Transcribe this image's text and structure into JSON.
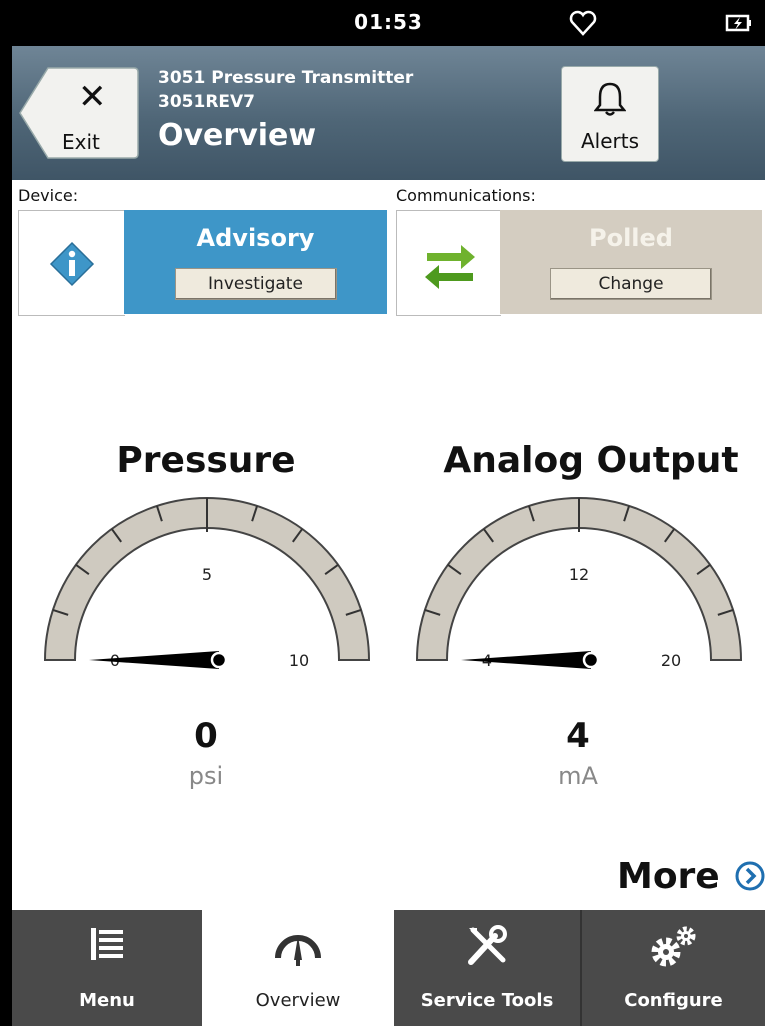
{
  "status_bar": {
    "time": "01:53",
    "heart_icon": "heart-icon",
    "battery_icon": "battery-charging-icon"
  },
  "header": {
    "exit_label": "Exit",
    "device_name": "3051 Pressure Transmitter",
    "device_rev": "3051REV7",
    "title": "Overview",
    "alerts_label": "Alerts"
  },
  "device": {
    "section_label": "Device:",
    "status": "Advisory",
    "button": "Investigate",
    "icon": "info-icon",
    "color": "#3e96c8"
  },
  "communications": {
    "section_label": "Communications:",
    "status": "Polled",
    "button": "Change",
    "icon": "arrows-exchange-icon",
    "color": "#d4cdc1"
  },
  "gauges": [
    {
      "title": "Pressure",
      "min": "0",
      "mid": "5",
      "max": "10",
      "value": "0",
      "unit": "psi",
      "needle_fraction": 0
    },
    {
      "title": "Analog Output",
      "min": "4",
      "mid": "12",
      "max": "20",
      "value": "4",
      "unit": "mA",
      "needle_fraction": 0
    }
  ],
  "more_label": "More",
  "nav": [
    {
      "label": "Menu",
      "icon": "menu-list-icon"
    },
    {
      "label": "Overview",
      "icon": "gauge-icon",
      "active": true
    },
    {
      "label": "Service Tools",
      "icon": "tools-icon"
    },
    {
      "label": "Configure",
      "icon": "gears-icon"
    }
  ]
}
